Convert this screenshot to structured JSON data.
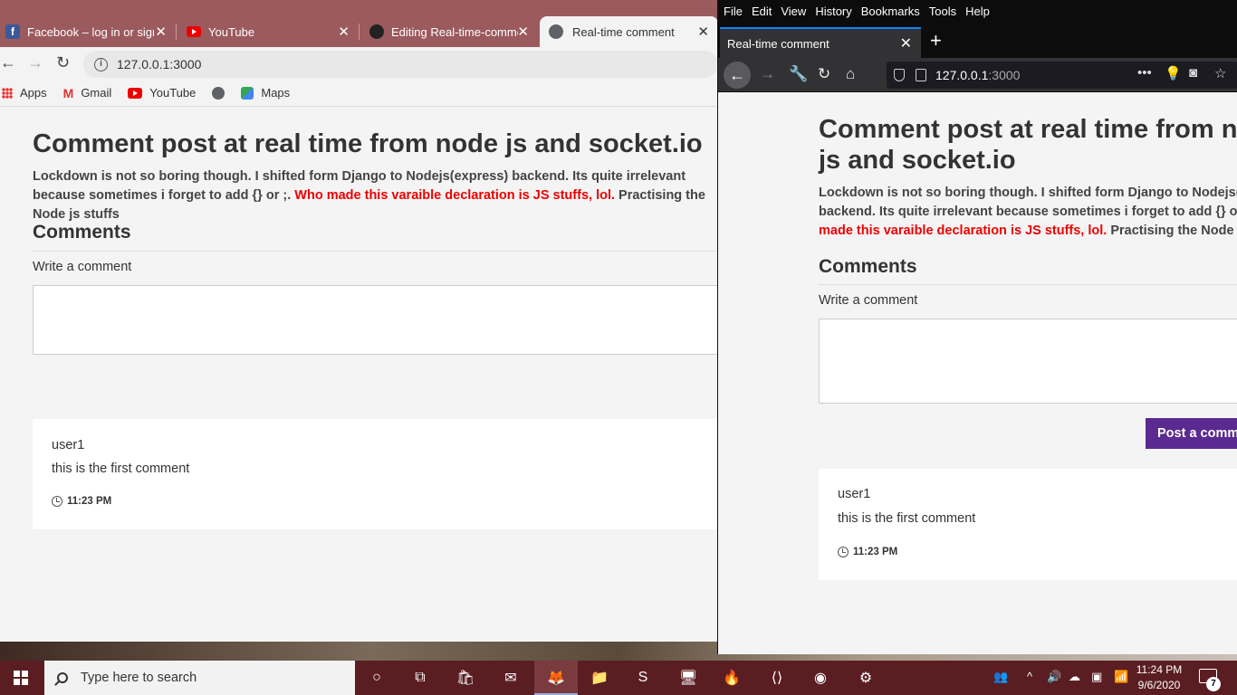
{
  "chrome": {
    "tabs": [
      {
        "title": "Facebook – log in or sign up",
        "icon": "facebook-icon"
      },
      {
        "title": "YouTube",
        "icon": "youtube-icon"
      },
      {
        "title": "Editing Real-time-comment",
        "icon": "github-icon"
      },
      {
        "title": "Real-time comment",
        "icon": "globe-icon"
      }
    ],
    "address": "127.0.0.1:3000",
    "bookmarks": [
      "Apps",
      "Gmail",
      "YouTube",
      "",
      "Maps"
    ]
  },
  "page": {
    "title": "Comment post at real time from node js and socket.io",
    "intro_before": "Lockdown is not so boring though. I shifted form Django to Nodejs(express) backend. Its quite irrelevant because sometimes i forget to add {} or ;.",
    "intro_red": "Who made this varaible declaration is JS stuffs, lol.",
    "intro_after": "Practising the Node js stuffs",
    "comments_heading": "Comments",
    "write_label": "Write a comment",
    "post_button": "Post a comment",
    "comment": {
      "user": "user1",
      "text": "this is the first comment",
      "time": "11:23 PM"
    }
  },
  "firefox": {
    "menu": [
      "File",
      "Edit",
      "View",
      "History",
      "Bookmarks",
      "Tools",
      "Help"
    ],
    "tab_title": "Real-time comment",
    "address_host": "127.0.0.1",
    "address_port": ":3000",
    "h1_line1": "Comment post at real time from node",
    "h1_line2": "js and socket.io",
    "intro_line1": "Lockdown is not so boring though. I shifted form Django to Nodejs(express)",
    "intro_line2": "backend. Its quite irrelevant because sometimes i forget to add {} or ;. Who",
    "intro_line3_red": "made this varaible declaration is JS stuffs, lol.",
    "intro_line3_after": "Practising the Node js stuffs"
  },
  "taskbar": {
    "search_placeholder": "Type here to search",
    "time": "11:24 PM",
    "date": "9/6/2020",
    "notifications": "7"
  },
  "colors": {
    "accent_red": "#e00000",
    "post_button": "#5b2a91",
    "chrome_tabbar": "#9b5a5e",
    "taskbar": "#5a1e22"
  }
}
